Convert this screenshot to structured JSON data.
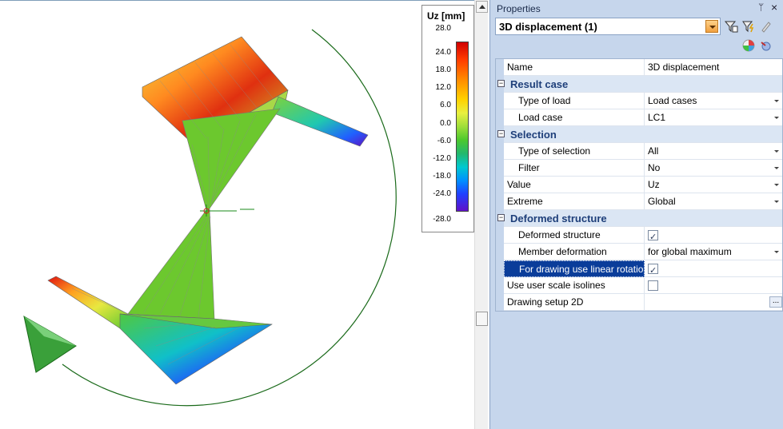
{
  "legend": {
    "title": "Uz [mm]",
    "ticks": [
      "28.0",
      "24.0",
      "18.0",
      "12.0",
      "6.0",
      "0.0",
      "-6.0",
      "-12.0",
      "-18.0",
      "-24.0",
      "-28.0"
    ]
  },
  "panel": {
    "title": "Properties",
    "pin_glyph": "ᛘ",
    "close_glyph": "×",
    "selector_value": "3D displacement (1)"
  },
  "grid": {
    "name_label": "Name",
    "name_value": "3D displacement",
    "result_case": "Result case",
    "type_of_load_label": "Type of load",
    "type_of_load_value": "Load cases",
    "load_case_label": "Load case",
    "load_case_value": "LC1",
    "selection": "Selection",
    "type_of_selection_label": "Type of selection",
    "type_of_selection_value": "All",
    "filter_label": "Filter",
    "filter_value": "No",
    "value_label": "Value",
    "value_value": "Uz",
    "extreme_label": "Extreme",
    "extreme_value": "Global",
    "deformed_structure_cat": "Deformed structure",
    "deformed_structure_label": "Deformed structure",
    "member_deformation_label": "Member deformation",
    "member_deformation_value": "for global maximum",
    "linear_rotation_label": "For drawing use linear rotation",
    "user_scale_label": "Use user scale isolines",
    "drawing_setup_label": "Drawing setup 2D",
    "ellipsis": "..."
  }
}
